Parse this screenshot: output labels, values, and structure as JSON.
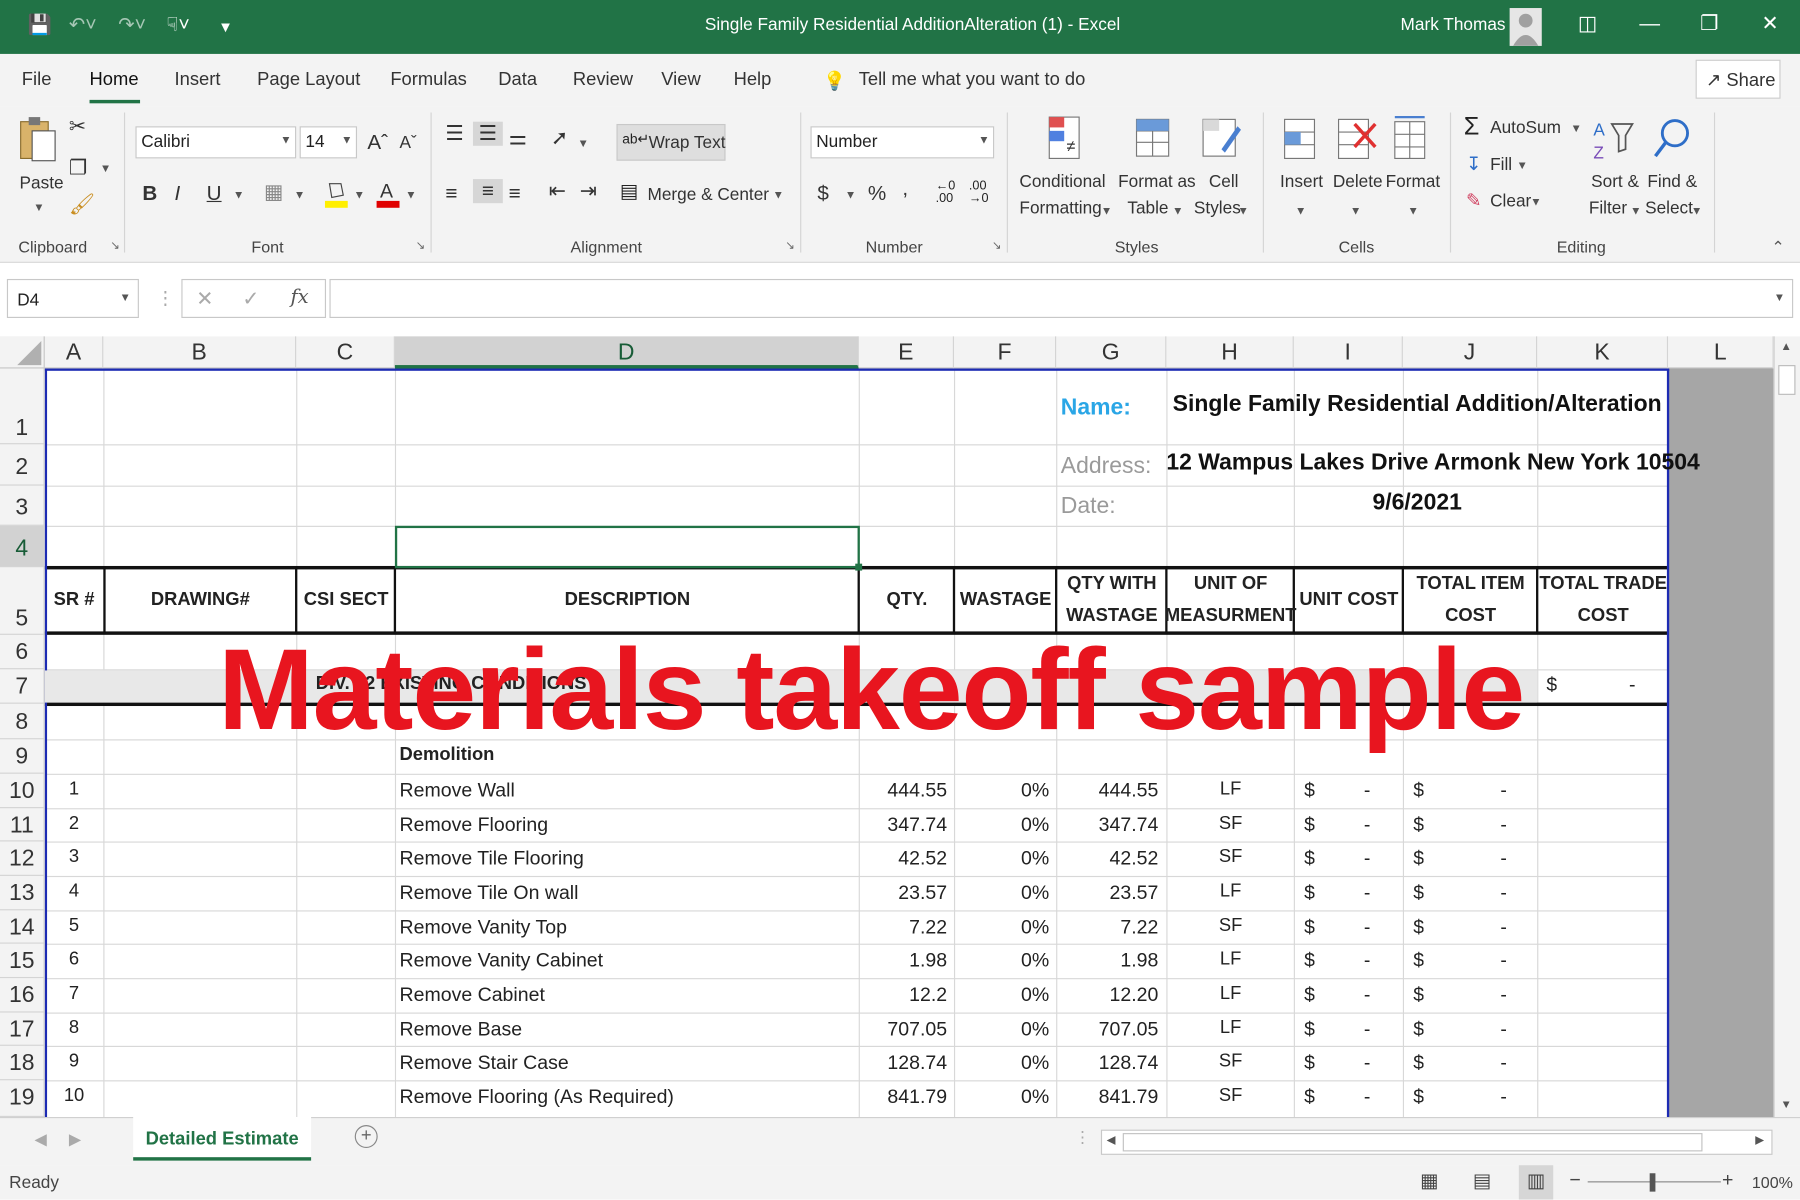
{
  "title_bar": {
    "title": "Single Family Residential AdditionAlteration (1)  -  Excel",
    "user": "Mark Thomas"
  },
  "menu": {
    "items": [
      "File",
      "Home",
      "Insert",
      "Page Layout",
      "Formulas",
      "Data",
      "Review",
      "View",
      "Help"
    ],
    "tell_me": "Tell me what you want to do",
    "share": "Share"
  },
  "ribbon": {
    "clipboard": {
      "paste": "Paste",
      "label": "Clipboard"
    },
    "font": {
      "name": "Calibri",
      "size": "14",
      "label": "Font"
    },
    "alignment": {
      "wrap_text": "Wrap Text",
      "merge_center": "Merge & Center",
      "label": "Alignment"
    },
    "number": {
      "format": "Number",
      "label": "Number"
    },
    "styles": {
      "conditional_1": "Conditional",
      "conditional_2": "Formatting",
      "format_as_1": "Format as",
      "format_as_2": "Table",
      "cell_1": "Cell",
      "cell_2": "Styles",
      "label": "Styles"
    },
    "cells": {
      "insert": "Insert",
      "delete": "Delete",
      "format": "Format",
      "label": "Cells"
    },
    "editing": {
      "autosum": "AutoSum",
      "fill": "Fill",
      "clear": "Clear",
      "sort_1": "Sort &",
      "sort_2": "Filter",
      "find_1": "Find &",
      "find_2": "Select",
      "label": "Editing"
    }
  },
  "formula_bar": {
    "name_box": "D4",
    "content": ""
  },
  "columns": [
    "A",
    "B",
    "C",
    "D",
    "E",
    "F",
    "G",
    "H",
    "I",
    "J",
    "K",
    "L"
  ],
  "rows": [
    "1",
    "2",
    "3",
    "4",
    "5",
    "6",
    "7",
    "8",
    "9",
    "10",
    "11",
    "12",
    "13",
    "14",
    "15",
    "16",
    "17",
    "18",
    "19"
  ],
  "info": {
    "name_label": "Name:",
    "name_value": "Single Family Residential Addition/Alteration",
    "address_label": "Address:",
    "address_value": "12 Wampus Lakes Drive Armonk New York 10504",
    "date_label": "Date:",
    "date_value": "9/6/2021"
  },
  "table_headers": {
    "sr": "SR #",
    "drawing": "DRAWING#",
    "csi": "CSI SECT",
    "description": "DESCRIPTION",
    "qty": "QTY.",
    "wastage": "WASTAGE",
    "qty_wastage_1": "QTY WITH",
    "qty_wastage_2": "WASTAGE",
    "unit_1": "UNIT OF",
    "unit_2": "MEASURMENT",
    "unit_cost": "UNIT COST",
    "total_item_1": "TOTAL ITEM",
    "total_item_2": "COST",
    "total_trade_1": "TOTAL TRADE",
    "total_trade_2": "COST"
  },
  "division": {
    "text": "DIV. 02 EXISTING CONDITIONS",
    "total_symbol": "$",
    "total_value": "-"
  },
  "section_title": "Demolition",
  "line_items": [
    {
      "sr": "1",
      "desc": "Remove Wall",
      "qty": "444.55",
      "wastage": "0%",
      "qty_w": "444.55",
      "unit": "LF",
      "unit_cost": "-",
      "total": "-"
    },
    {
      "sr": "2",
      "desc": "Remove Flooring",
      "qty": "347.74",
      "wastage": "0%",
      "qty_w": "347.74",
      "unit": "SF",
      "unit_cost": "-",
      "total": "-"
    },
    {
      "sr": "3",
      "desc": "Remove Tile Flooring",
      "qty": "42.52",
      "wastage": "0%",
      "qty_w": "42.52",
      "unit": "SF",
      "unit_cost": "-",
      "total": "-"
    },
    {
      "sr": "4",
      "desc": "Remove Tile On wall",
      "qty": "23.57",
      "wastage": "0%",
      "qty_w": "23.57",
      "unit": "LF",
      "unit_cost": "-",
      "total": "-"
    },
    {
      "sr": "5",
      "desc": "Remove Vanity Top",
      "qty": "7.22",
      "wastage": "0%",
      "qty_w": "7.22",
      "unit": "SF",
      "unit_cost": "-",
      "total": "-"
    },
    {
      "sr": "6",
      "desc": "Remove Vanity Cabinet",
      "qty": "1.98",
      "wastage": "0%",
      "qty_w": "1.98",
      "unit": "LF",
      "unit_cost": "-",
      "total": "-"
    },
    {
      "sr": "7",
      "desc": "Remove Cabinet",
      "qty": "12.2",
      "wastage": "0%",
      "qty_w": "12.20",
      "unit": "LF",
      "unit_cost": "-",
      "total": "-"
    },
    {
      "sr": "8",
      "desc": "Remove Base",
      "qty": "707.05",
      "wastage": "0%",
      "qty_w": "707.05",
      "unit": "LF",
      "unit_cost": "-",
      "total": "-"
    },
    {
      "sr": "9",
      "desc": "Remove Stair Case",
      "qty": "128.74",
      "wastage": "0%",
      "qty_w": "128.74",
      "unit": "SF",
      "unit_cost": "-",
      "total": "-"
    },
    {
      "sr": "10",
      "desc": "Remove Flooring (As Required)",
      "qty": "841.79",
      "wastage": "0%",
      "qty_w": "841.79",
      "unit": "SF",
      "unit_cost": "-",
      "total": "-"
    }
  ],
  "currency_symbol": "$",
  "watermark": "Materials takeoff sample",
  "sheet_tab": "Detailed Estimate",
  "status": {
    "ready": "Ready",
    "zoom": "100%"
  },
  "colors": {
    "excel_green": "#217346",
    "watermark_red": "#e8151f",
    "name_label_blue": "#2aa6e6",
    "table_border_blue": "#1d2bb3"
  }
}
